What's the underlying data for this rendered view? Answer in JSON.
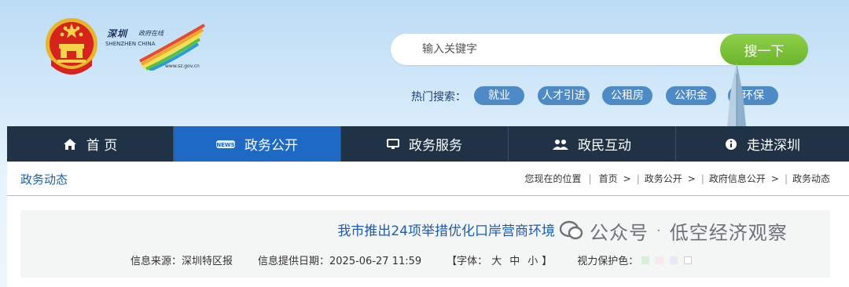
{
  "logo": {
    "cn_title": "深圳",
    "cn_subtitle": "政府在线",
    "en_line1": "SHENZHEN",
    "en_line2": "CHINA",
    "url": "www.sz.gov.cn"
  },
  "search": {
    "placeholder": "输入关键字",
    "button_label": "搜一下"
  },
  "hot_search": {
    "label": "热门搜索：",
    "tags": [
      "就业",
      "人才引进",
      "公租房",
      "公积金",
      "环保"
    ]
  },
  "nav": {
    "items": [
      {
        "label": "首 页",
        "icon": "home-icon"
      },
      {
        "label": "政务公开",
        "icon": "news-icon",
        "active": true
      },
      {
        "label": "政务服务",
        "icon": "monitor-icon"
      },
      {
        "label": "政民互动",
        "icon": "people-icon"
      },
      {
        "label": "走进深圳",
        "icon": "info-icon"
      }
    ]
  },
  "section": {
    "title": "政务动态"
  },
  "breadcrumb": {
    "location_label": "您现在的位置",
    "items": [
      "首页",
      "政务公开",
      "政府信息公开",
      "政务动态"
    ],
    "separator": ">"
  },
  "article": {
    "title": "我市推出24项举措优化口岸营商环境",
    "source": "信息来源：深圳特区报",
    "date": "信息提供日期：2025-06-27 11:59",
    "font_label_open": "【字体：",
    "font_sizes": [
      "大",
      "中",
      "小"
    ],
    "font_label_close": "】",
    "eye_care_label": "视力保护色："
  },
  "watermark": {
    "prefix": "公众号",
    "dot": "·",
    "name": "低空经济观察"
  },
  "colors": {
    "nav_bg": "#1f3246",
    "nav_active": "#1d69c4",
    "search_btn": "#7cc23b",
    "hot_tag": "#4e8bc6",
    "title_blue": "#1e5cb3",
    "section_line": "#9fd37a"
  }
}
